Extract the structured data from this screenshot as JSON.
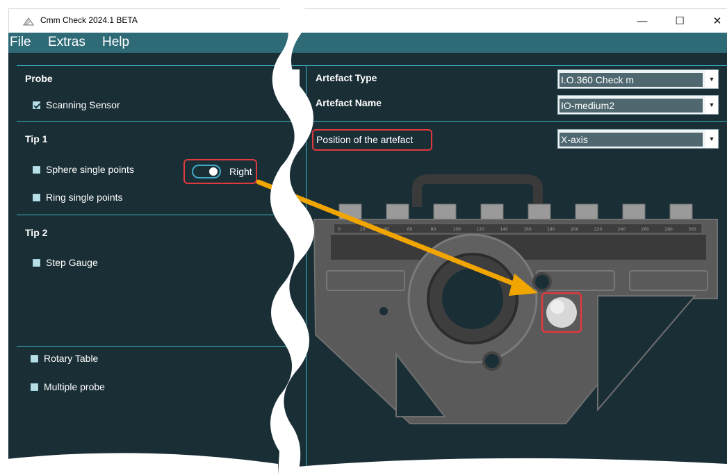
{
  "window": {
    "title": "Cmm Check 2024.1 BETA",
    "minimize": "—",
    "maximize": "☐",
    "close": "✕"
  },
  "menu": [
    "File",
    "Extras",
    "Help"
  ],
  "left": {
    "probe": {
      "title": "Probe",
      "scanning_sensor": "Scanning Sensor"
    },
    "tip1": {
      "title": "Tip 1",
      "sphere": "Sphere single points",
      "ring": "Ring single points",
      "toggle_label": "Right"
    },
    "tip2": {
      "title": "Tip 2",
      "step_gauge": "Step Gauge"
    },
    "bottom": {
      "rotary": "Rotary Table",
      "multiple": "Multiple probe"
    }
  },
  "right": {
    "artefact_type_label": "Artefact Type",
    "artefact_type_value": "I.O.360 Check m",
    "artefact_name_label": "Artefact Name",
    "artefact_name_value": "IO-medium2",
    "position_label": "Position of the artefact",
    "position_value": "X-axis"
  },
  "scale_ticks": [
    "0",
    "20",
    "40",
    "60",
    "80",
    "100",
    "120",
    "140",
    "160",
    "180",
    "200",
    "220",
    "240",
    "260",
    "280",
    "300"
  ],
  "colors": {
    "background": "#1a2e36",
    "menubar": "#2e6b77",
    "divider": "#3bb7c7",
    "highlight": "#e0393e",
    "arrow": "#f0a500"
  }
}
